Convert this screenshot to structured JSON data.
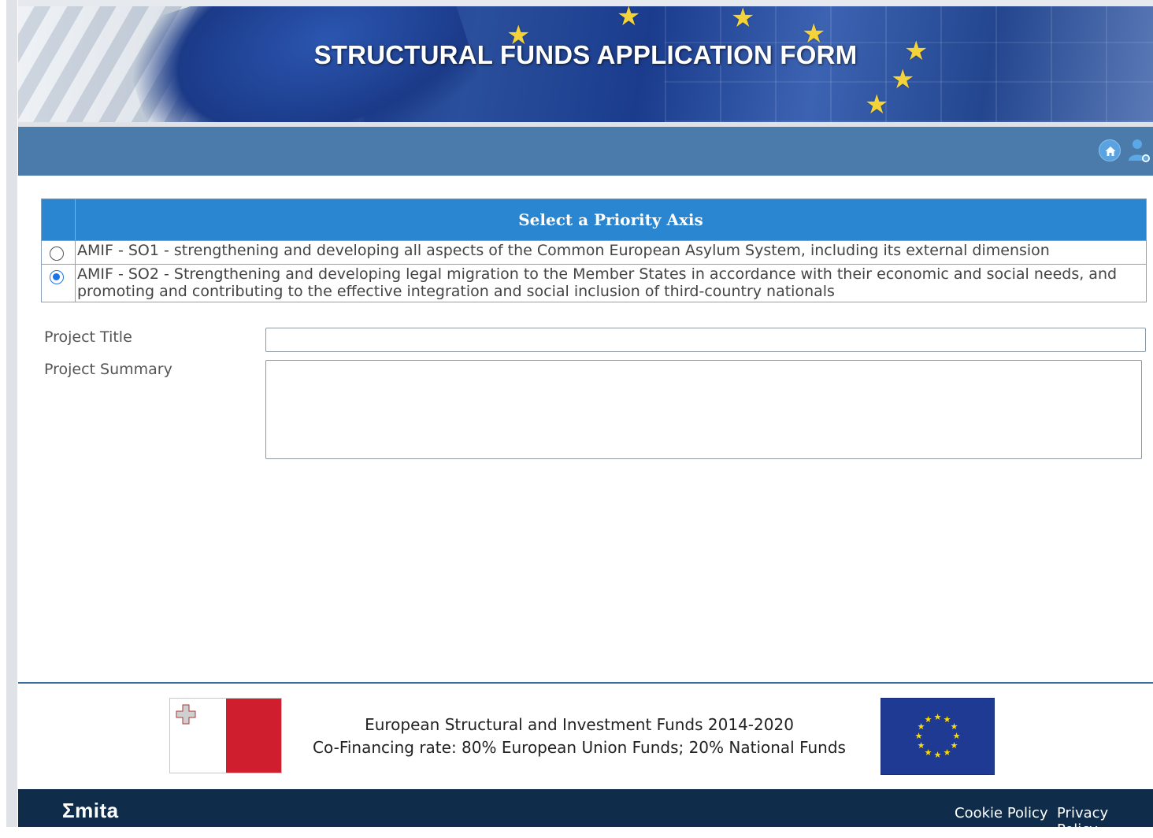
{
  "header": {
    "title": "STRUCTURAL FUNDS APPLICATION FORM"
  },
  "nav": {
    "home_icon": "home-icon",
    "user_icon": "user-account-icon"
  },
  "priority_axis": {
    "heading": "Select a Priority Axis",
    "options": [
      {
        "label": "AMIF - SO1 - strengthening and developing all aspects of the Common European Asylum System, including its external dimension",
        "selected": false
      },
      {
        "label": "AMIF - SO2 - Strengthening and developing legal migration to the Member States in accordance with their economic and social needs, and promoting and contributing to the effective integration and social inclusion of third-country nationals",
        "selected": true
      }
    ]
  },
  "form": {
    "project_title_label": "Project Title",
    "project_title_value": "",
    "project_summary_label": "Project Summary",
    "project_summary_value": ""
  },
  "footer": {
    "funds_line": "European Structural and Investment Funds 2014-2020",
    "cofinancing_line": "Co-Financing rate: 80% European Union Funds; 20% National Funds",
    "logo_text": "mita",
    "cookie_policy": "Cookie Policy",
    "privacy_policy": "Privacy Policy"
  },
  "colors": {
    "nav_bar": "#4a7bab",
    "table_header": "#2a86d1",
    "bottom_bar": "#0f2d4a",
    "malta_red": "#cf1f2e",
    "eu_blue": "#1f3a93"
  }
}
